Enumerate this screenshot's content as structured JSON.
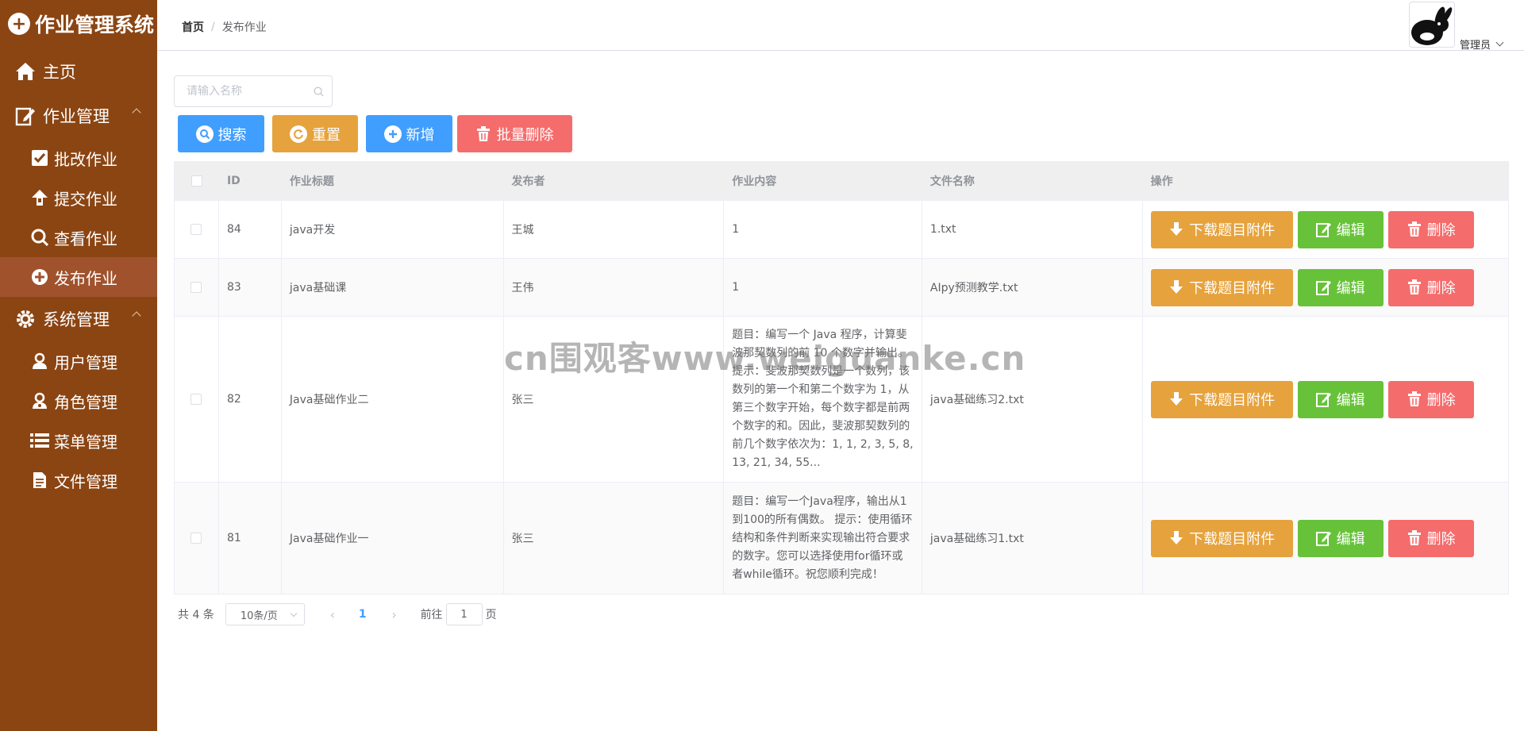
{
  "app": {
    "title": "作业管理系统"
  },
  "sidebar": {
    "items": [
      {
        "label": "主页",
        "icon": "home-icon"
      },
      {
        "label": "作业管理",
        "icon": "edit-icon",
        "expanded": true,
        "children": [
          {
            "label": "批改作业",
            "icon": "check-square-icon"
          },
          {
            "label": "提交作业",
            "icon": "upload-icon"
          },
          {
            "label": "查看作业",
            "icon": "search-icon"
          },
          {
            "label": "发布作业",
            "icon": "publish-icon",
            "active": true
          }
        ]
      },
      {
        "label": "系统管理",
        "icon": "gear-icon",
        "expanded": true,
        "children": [
          {
            "label": "用户管理",
            "icon": "user-icon"
          },
          {
            "label": "角色管理",
            "icon": "role-icon"
          },
          {
            "label": "菜单管理",
            "icon": "list-icon"
          },
          {
            "label": "文件管理",
            "icon": "file-icon"
          }
        ]
      }
    ]
  },
  "header": {
    "breadcrumb_home": "首页",
    "breadcrumb_sep": "/",
    "breadcrumb_current": "发布作业",
    "user_name": "管理员"
  },
  "search": {
    "placeholder": "请输入名称"
  },
  "toolbar": {
    "search_label": "搜索",
    "reset_label": "重置",
    "add_label": "新增",
    "batch_delete_label": "批量删除"
  },
  "table": {
    "columns": [
      "ID",
      "作业标题",
      "发布者",
      "作业内容",
      "文件名称",
      "操作"
    ],
    "rows": [
      {
        "id": "84",
        "title": "java开发",
        "publisher": "王城",
        "content": "1",
        "file": "1.txt"
      },
      {
        "id": "83",
        "title": "java基础课",
        "publisher": "王伟",
        "content": "1",
        "file": "AIpy预测教学.txt"
      },
      {
        "id": "82",
        "title": "Java基础作业二",
        "publisher": "张三",
        "content": "题目：编写一个 Java 程序，计算斐波那契数列的前 10 个数字并输出。 提示：斐波那契数列是一个数列，该数列的第一个和第二个数字为 1，从第三个数字开始，每个数字都是前两个数字的和。因此，斐波那契数列的前几个数字依次为：1, 1, 2, 3, 5, 8, 13, 21, 34, 55...",
        "file": "java基础练习2.txt"
      },
      {
        "id": "81",
        "title": "Java基础作业一",
        "publisher": "张三",
        "content": "题目：编写一个Java程序，输出从1到100的所有偶数。 提示：使用循环结构和条件判断来实现输出符合要求的数字。您可以选择使用for循环或者while循环。祝您顺利完成！",
        "file": "java基础练习1.txt"
      }
    ],
    "ops": {
      "download_label": "下载题目附件",
      "edit_label": "编辑",
      "delete_label": "删除"
    }
  },
  "pagination": {
    "total_text": "共 4 条",
    "page_size": "10条/页",
    "current_page": "1",
    "goto_prefix": "前往",
    "goto_value": "1",
    "goto_suffix": "页"
  },
  "watermark": "cn围观客www.weiguanke.cn",
  "colors": {
    "sidebar_bg": "#8b4513",
    "sidebar_active": "#a0522d",
    "primary": "#409eff",
    "warning": "#e6a23c",
    "danger": "#f56c6c",
    "success": "#67c23a"
  }
}
